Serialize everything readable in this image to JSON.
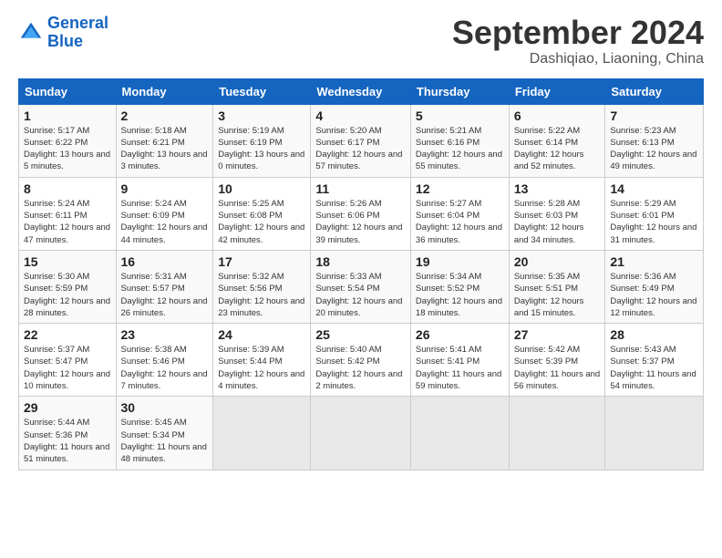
{
  "header": {
    "logo_line1": "General",
    "logo_line2": "Blue",
    "month": "September 2024",
    "location": "Dashiqiao, Liaoning, China"
  },
  "weekdays": [
    "Sunday",
    "Monday",
    "Tuesday",
    "Wednesday",
    "Thursday",
    "Friday",
    "Saturday"
  ],
  "weeks": [
    [
      {
        "day": "1",
        "info": "Sunrise: 5:17 AM\nSunset: 6:22 PM\nDaylight: 13 hours and 5 minutes."
      },
      {
        "day": "2",
        "info": "Sunrise: 5:18 AM\nSunset: 6:21 PM\nDaylight: 13 hours and 3 minutes."
      },
      {
        "day": "3",
        "info": "Sunrise: 5:19 AM\nSunset: 6:19 PM\nDaylight: 13 hours and 0 minutes."
      },
      {
        "day": "4",
        "info": "Sunrise: 5:20 AM\nSunset: 6:17 PM\nDaylight: 12 hours and 57 minutes."
      },
      {
        "day": "5",
        "info": "Sunrise: 5:21 AM\nSunset: 6:16 PM\nDaylight: 12 hours and 55 minutes."
      },
      {
        "day": "6",
        "info": "Sunrise: 5:22 AM\nSunset: 6:14 PM\nDaylight: 12 hours and 52 minutes."
      },
      {
        "day": "7",
        "info": "Sunrise: 5:23 AM\nSunset: 6:13 PM\nDaylight: 12 hours and 49 minutes."
      }
    ],
    [
      {
        "day": "8",
        "info": "Sunrise: 5:24 AM\nSunset: 6:11 PM\nDaylight: 12 hours and 47 minutes."
      },
      {
        "day": "9",
        "info": "Sunrise: 5:24 AM\nSunset: 6:09 PM\nDaylight: 12 hours and 44 minutes."
      },
      {
        "day": "10",
        "info": "Sunrise: 5:25 AM\nSunset: 6:08 PM\nDaylight: 12 hours and 42 minutes."
      },
      {
        "day": "11",
        "info": "Sunrise: 5:26 AM\nSunset: 6:06 PM\nDaylight: 12 hours and 39 minutes."
      },
      {
        "day": "12",
        "info": "Sunrise: 5:27 AM\nSunset: 6:04 PM\nDaylight: 12 hours and 36 minutes."
      },
      {
        "day": "13",
        "info": "Sunrise: 5:28 AM\nSunset: 6:03 PM\nDaylight: 12 hours and 34 minutes."
      },
      {
        "day": "14",
        "info": "Sunrise: 5:29 AM\nSunset: 6:01 PM\nDaylight: 12 hours and 31 minutes."
      }
    ],
    [
      {
        "day": "15",
        "info": "Sunrise: 5:30 AM\nSunset: 5:59 PM\nDaylight: 12 hours and 28 minutes."
      },
      {
        "day": "16",
        "info": "Sunrise: 5:31 AM\nSunset: 5:57 PM\nDaylight: 12 hours and 26 minutes."
      },
      {
        "day": "17",
        "info": "Sunrise: 5:32 AM\nSunset: 5:56 PM\nDaylight: 12 hours and 23 minutes."
      },
      {
        "day": "18",
        "info": "Sunrise: 5:33 AM\nSunset: 5:54 PM\nDaylight: 12 hours and 20 minutes."
      },
      {
        "day": "19",
        "info": "Sunrise: 5:34 AM\nSunset: 5:52 PM\nDaylight: 12 hours and 18 minutes."
      },
      {
        "day": "20",
        "info": "Sunrise: 5:35 AM\nSunset: 5:51 PM\nDaylight: 12 hours and 15 minutes."
      },
      {
        "day": "21",
        "info": "Sunrise: 5:36 AM\nSunset: 5:49 PM\nDaylight: 12 hours and 12 minutes."
      }
    ],
    [
      {
        "day": "22",
        "info": "Sunrise: 5:37 AM\nSunset: 5:47 PM\nDaylight: 12 hours and 10 minutes."
      },
      {
        "day": "23",
        "info": "Sunrise: 5:38 AM\nSunset: 5:46 PM\nDaylight: 12 hours and 7 minutes."
      },
      {
        "day": "24",
        "info": "Sunrise: 5:39 AM\nSunset: 5:44 PM\nDaylight: 12 hours and 4 minutes."
      },
      {
        "day": "25",
        "info": "Sunrise: 5:40 AM\nSunset: 5:42 PM\nDaylight: 12 hours and 2 minutes."
      },
      {
        "day": "26",
        "info": "Sunrise: 5:41 AM\nSunset: 5:41 PM\nDaylight: 11 hours and 59 minutes."
      },
      {
        "day": "27",
        "info": "Sunrise: 5:42 AM\nSunset: 5:39 PM\nDaylight: 11 hours and 56 minutes."
      },
      {
        "day": "28",
        "info": "Sunrise: 5:43 AM\nSunset: 5:37 PM\nDaylight: 11 hours and 54 minutes."
      }
    ],
    [
      {
        "day": "29",
        "info": "Sunrise: 5:44 AM\nSunset: 5:36 PM\nDaylight: 11 hours and 51 minutes."
      },
      {
        "day": "30",
        "info": "Sunrise: 5:45 AM\nSunset: 5:34 PM\nDaylight: 11 hours and 48 minutes."
      },
      {
        "day": "",
        "info": ""
      },
      {
        "day": "",
        "info": ""
      },
      {
        "day": "",
        "info": ""
      },
      {
        "day": "",
        "info": ""
      },
      {
        "day": "",
        "info": ""
      }
    ]
  ]
}
